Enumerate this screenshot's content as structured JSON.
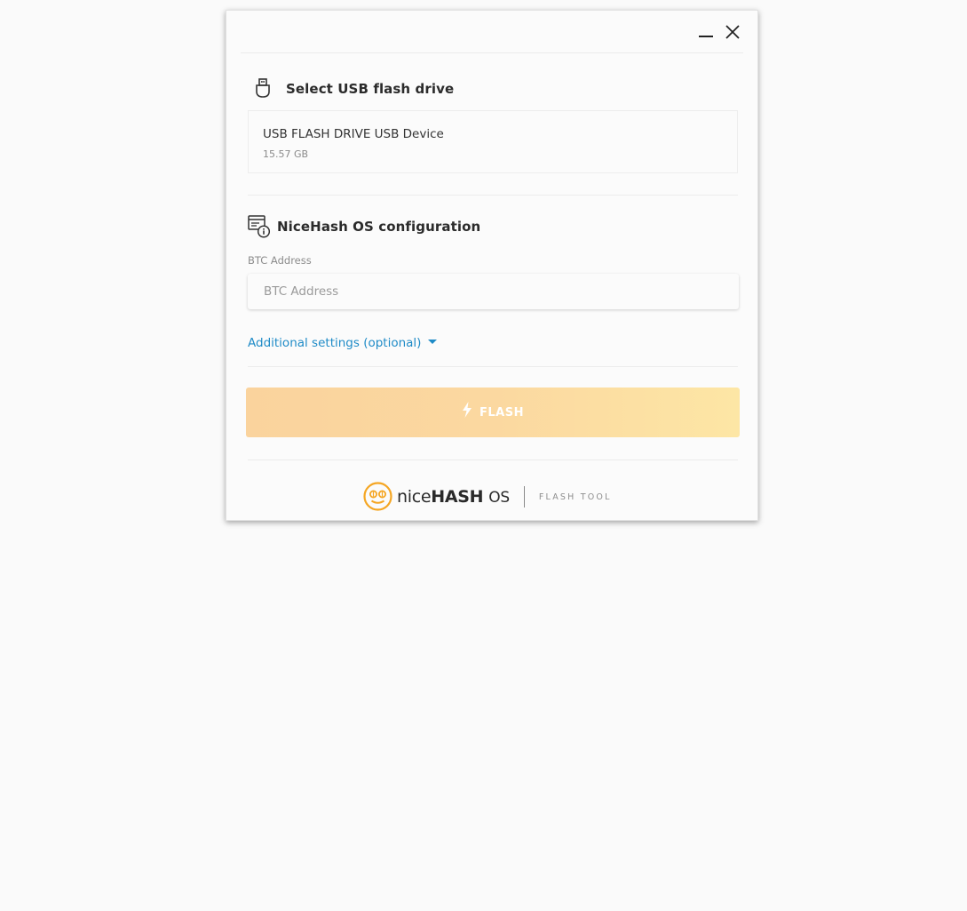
{
  "window": {
    "minimize_icon": "minimize-icon",
    "close_icon": "close-icon"
  },
  "usb": {
    "title": "Select USB flash drive",
    "icon": "usb-icon",
    "drive": {
      "name": "USB FLASH DRIVE USB Device",
      "size": "15.57 GB"
    }
  },
  "config": {
    "title": "NiceHash OS configuration",
    "icon": "config-info-icon",
    "btc_label": "BTC Address",
    "btc_placeholder": "BTC Address",
    "btc_value": "",
    "additional_label": "Additional settings (optional)"
  },
  "flash": {
    "label": "FLASH",
    "icon": "lightning-bolt-icon",
    "colors": {
      "start": "#fad39d",
      "end": "#fde6a5"
    }
  },
  "footer": {
    "brand_nice": "nice",
    "brand_hash": "HASH",
    "brand_os": "OS",
    "tool_label": "FLASH TOOL",
    "logo_color": "#f5a623"
  },
  "colors": {
    "link": "#1f8bc7",
    "background": "#fafafa"
  }
}
